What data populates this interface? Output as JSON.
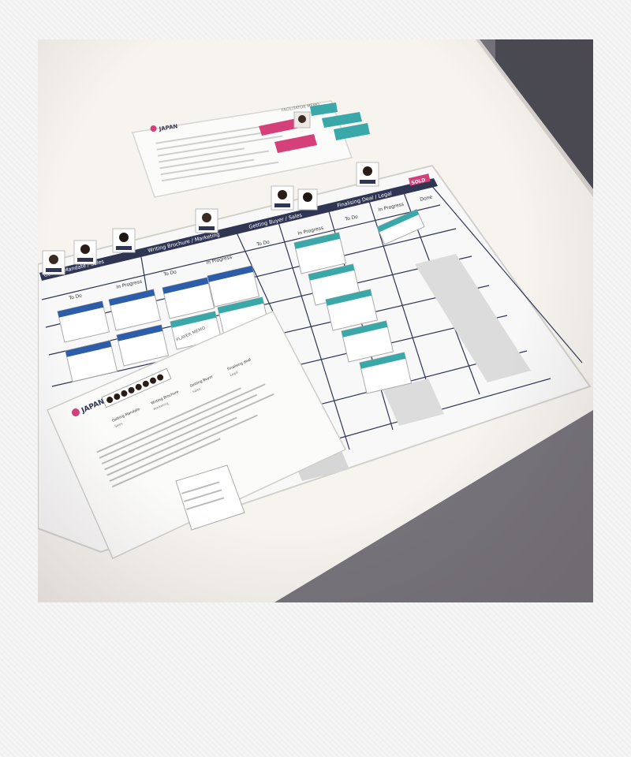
{
  "frame": {
    "type": "polaroid"
  },
  "board": {
    "section_headers": [
      "Getting Mandate / Sales",
      "Writing Brochure / Marketing",
      "Getting Buyer / Sales",
      "Finalising Deal / Legal"
    ],
    "column_headers": [
      "To Do",
      "In Progress",
      "To Do",
      "In Progress",
      "To Do",
      "In Progress",
      "To Do",
      "In Progress",
      "Done"
    ],
    "sold_label": "SOLD"
  },
  "facilitator_memo": {
    "title": "FACILITATOR MEMO",
    "brand": "JAPAN"
  },
  "player_memo": {
    "title": "PLAYER MEMO",
    "brand": "JAPAN",
    "steps": [
      "Getting Mandate",
      "Writing Brochure",
      "Getting Buyer",
      "Finalising deal"
    ],
    "step_owners": [
      "Sales",
      "Marketing",
      "Sales",
      "Legal"
    ]
  },
  "colors": {
    "header_navy": "#2f3552",
    "teal_card": "#3aa8a8",
    "pink_card": "#d6407a",
    "cell_gray": "#dcdcdc",
    "table_white": "#f6f3ee"
  }
}
